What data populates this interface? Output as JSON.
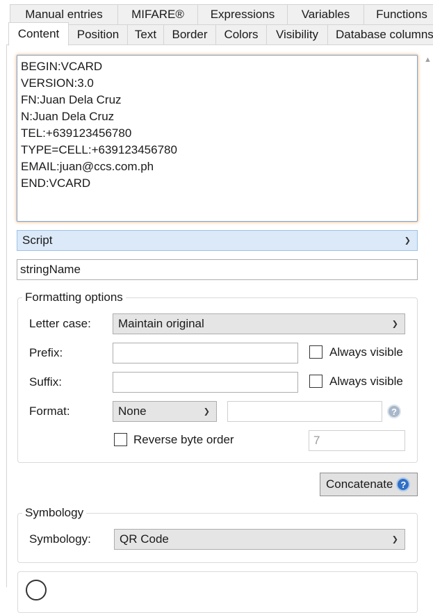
{
  "tabs_row1": [
    "Manual entries",
    "MIFARE®",
    "Expressions",
    "Variables",
    "Functions"
  ],
  "tabs_row2": [
    "Content",
    "Position",
    "Text",
    "Border",
    "Colors",
    "Visibility",
    "Database columns"
  ],
  "active_tab": "Content",
  "content": {
    "lines": [
      "BEGIN:VCARD",
      "VERSION:3.0",
      "FN:Juan Dela Cruz",
      "N:Juan Dela Cruz",
      "TEL:+639123456780",
      "TYPE=CELL:+639123456780",
      "EMAIL:juan@ccs.com.ph",
      "END:VCARD"
    ],
    "source_select": "Script",
    "name_value": "stringName"
  },
  "formatting": {
    "title": "Formatting options",
    "letter_case_label": "Letter case:",
    "letter_case_value": "Maintain original",
    "prefix_label": "Prefix:",
    "prefix_value": "",
    "suffix_label": "Suffix:",
    "suffix_value": "",
    "always_visible": "Always visible",
    "format_label": "Format:",
    "format_value": "None",
    "format_text_value": "",
    "reverse_byte_order": "Reverse byte order",
    "byte_value": "7"
  },
  "concatenate_label": "Concatenate",
  "symbology": {
    "title": "Symbology",
    "label": "Symbology:",
    "value": "QR Code"
  },
  "colors": {
    "focus_border": "#7aa7d8",
    "focus_glow": "#f6c79a",
    "select_blue": "#dbe9f8",
    "help_blue": "#2f6fc5"
  }
}
